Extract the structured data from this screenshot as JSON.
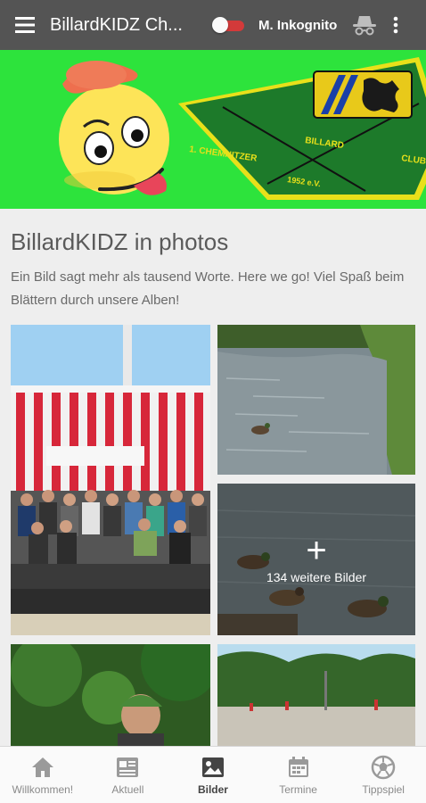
{
  "appbar": {
    "title": "BillardKIDZ Ch...",
    "user_name": "M. Inkognito",
    "toggle_on": false,
    "colors": {
      "bar": "#545454",
      "toggle_track": "#d33a3a"
    },
    "icons": {
      "menu": "menu-icon",
      "incognito": "incognito-icon",
      "more": "more-vert-icon"
    }
  },
  "banner": {
    "pennant_text_left": "1. CHEMNITZER",
    "pennant_text_mid": "BILLARD",
    "pennant_text_right": "CLUB",
    "pennant_year": "1952 e.V.",
    "colors": {
      "background": "#2de33c",
      "pennant": "#1d7a2a",
      "border": "#e8e01a"
    }
  },
  "content": {
    "title": "BillardKIDZ in photos",
    "description": "Ein Bild sagt mehr als tausend Worte. Here we go! Viel Spaß beim Blättern durch unsere Alben!",
    "more_photos_label": "134 weitere Bilder",
    "more_photos_icon": "plus-icon"
  },
  "bottom_nav": {
    "items": [
      {
        "label": "Willkommen!",
        "icon": "home-icon",
        "active": false
      },
      {
        "label": "Aktuell",
        "icon": "news-icon",
        "active": false
      },
      {
        "label": "Bilder",
        "icon": "image-icon",
        "active": true
      },
      {
        "label": "Termine",
        "icon": "calendar-icon",
        "active": false
      },
      {
        "label": "Tippspiel",
        "icon": "soccer-ball-icon",
        "active": false
      }
    ]
  }
}
